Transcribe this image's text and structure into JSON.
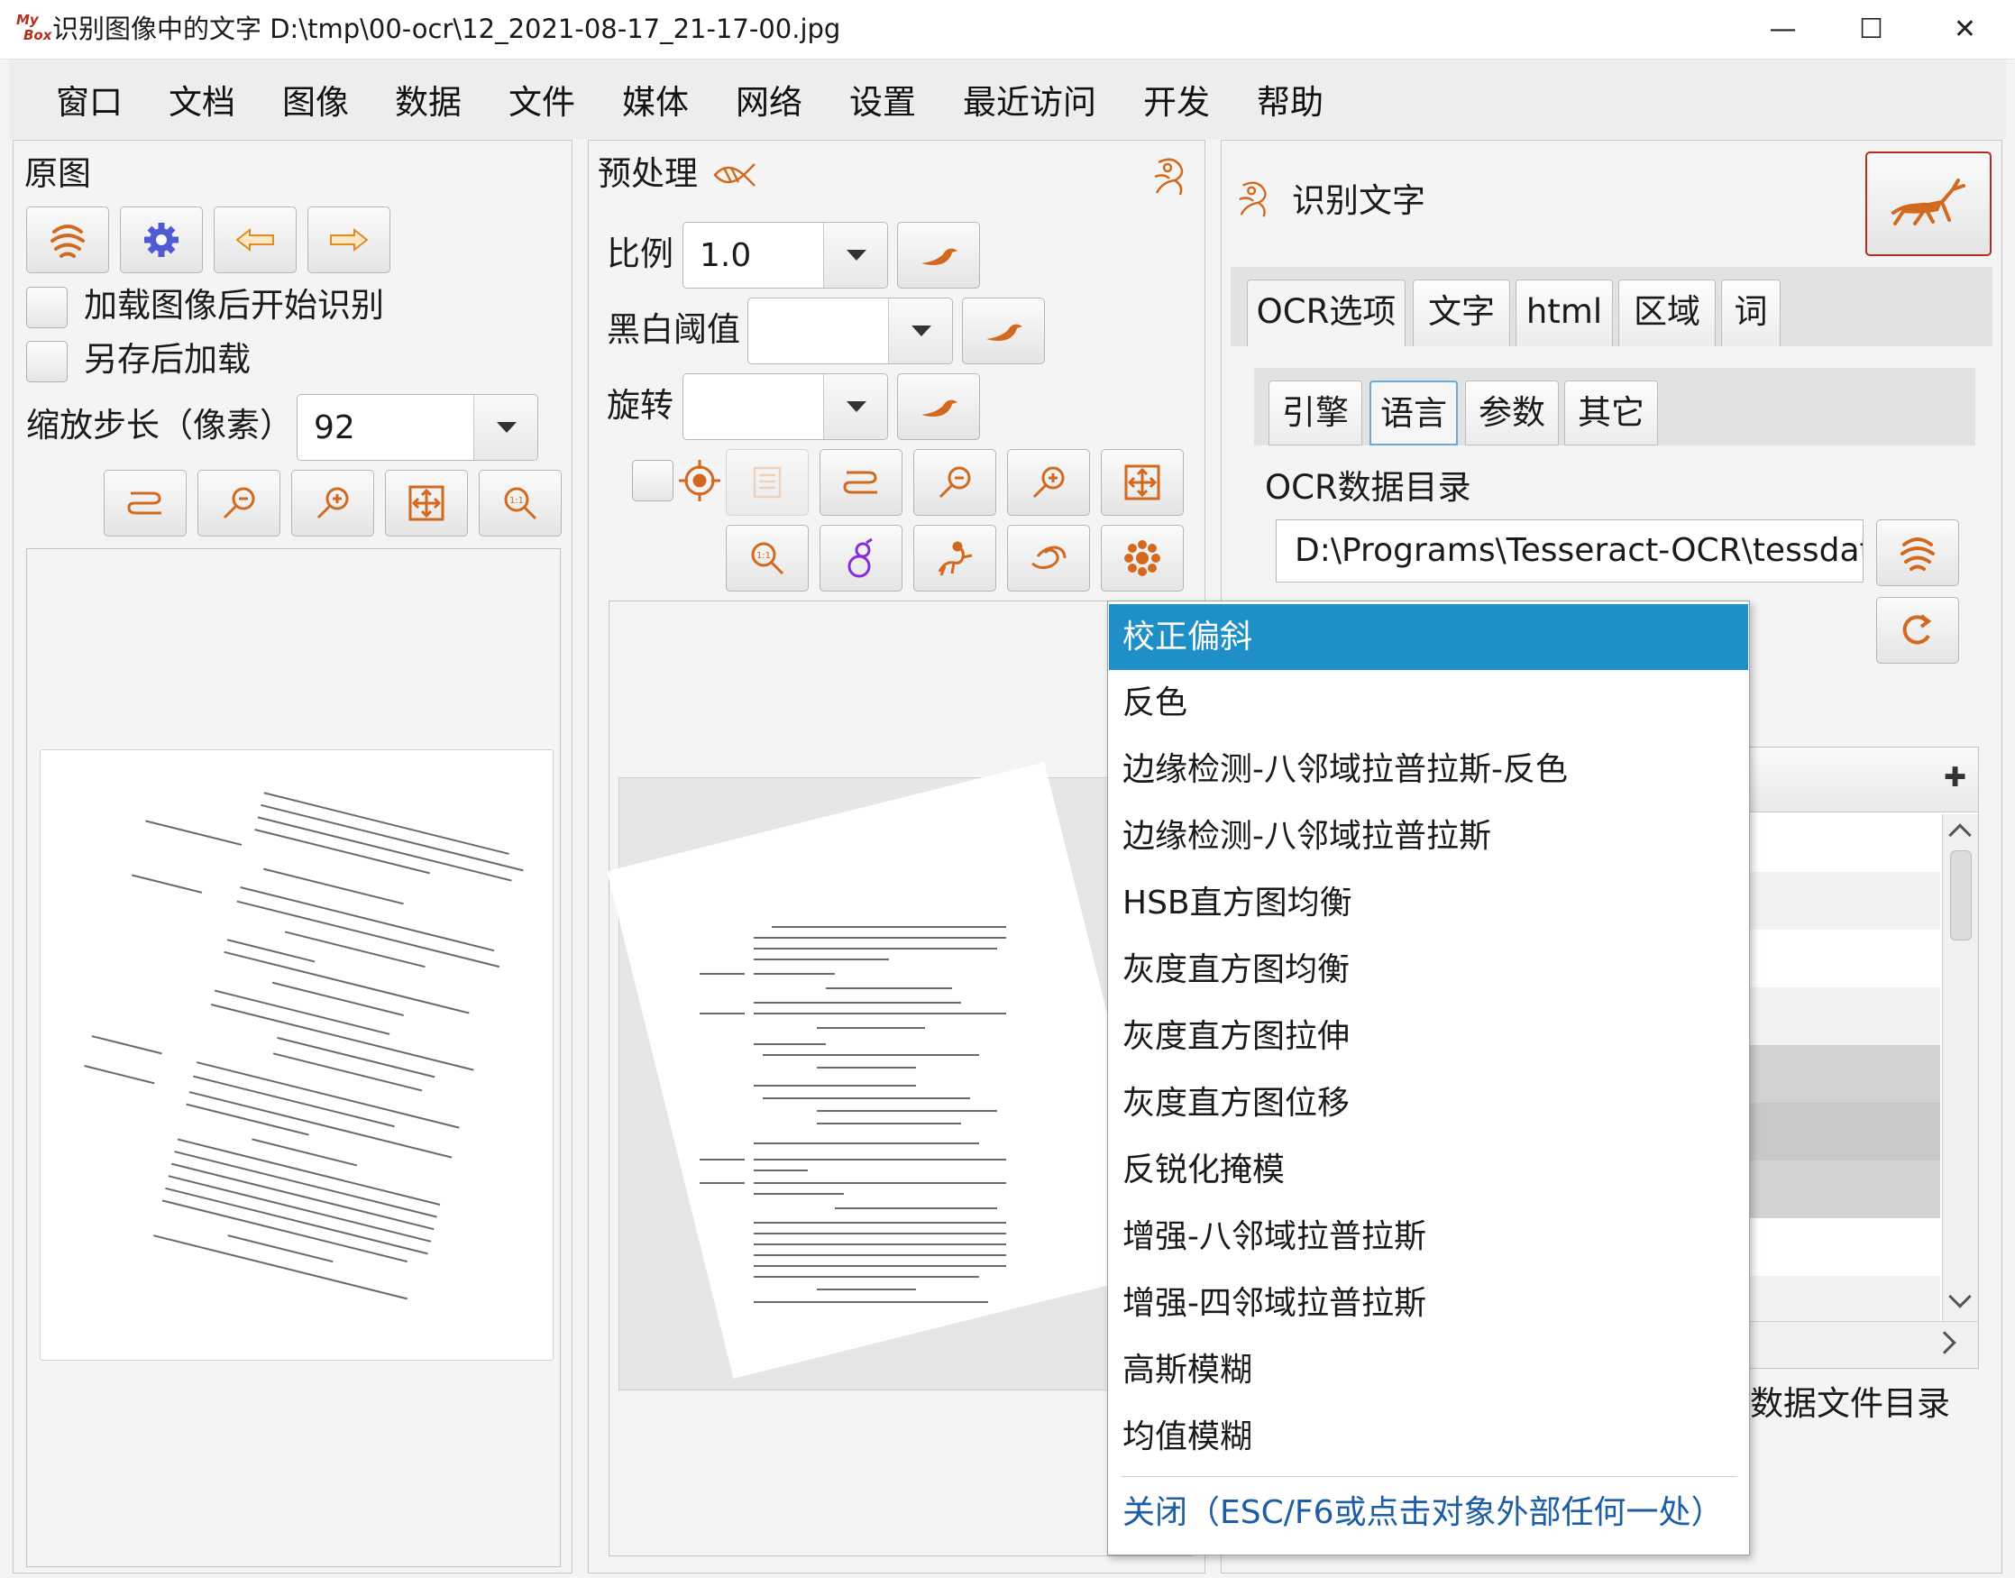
{
  "window": {
    "logo_top": "My",
    "logo_bottom": "Box",
    "title": "识别图像中的文字 D:\\tmp\\00-ocr\\12_2021-08-17_21-17-00.jpg",
    "controls": {
      "minimize": "—",
      "maximize": "☐",
      "close": "✕"
    }
  },
  "menu": [
    "窗口",
    "文档",
    "图像",
    "数据",
    "文件",
    "媒体",
    "网络",
    "设置",
    "最近访问",
    "开发",
    "帮助"
  ],
  "left_pane": {
    "title": "原图",
    "load_start_label": "加载图像后开始识别",
    "load_after_save_label": "另存后加载",
    "zoom_step_label": "缩放步长（像素）",
    "zoom_step_value": "92"
  },
  "mid_pane": {
    "title": "预处理",
    "scale_label": "比例",
    "scale_value": "1.0",
    "threshold_label": "黑白阈值",
    "threshold_value": "",
    "rotate_label": "旋转",
    "rotate_value": ""
  },
  "right_pane": {
    "title": "识别文字",
    "tabs": [
      "OCR选项",
      "文字",
      "html",
      "区域",
      "词"
    ],
    "active_tab": 0,
    "subtabs": [
      "引擎",
      "语言",
      "参数",
      "其它"
    ],
    "active_subtab": 1,
    "data_dir_label": "OCR数据目录",
    "data_dir_value": "D:\\Programs\\Tesseract-OCR\\tessdata",
    "data_file_dir_label": "数据文件目录",
    "add_symbol": "✚"
  },
  "popup_menu": {
    "items": [
      "校正偏斜",
      "反色",
      "边缘检测-八邻域拉普拉斯-反色",
      "边缘检测-八邻域拉普拉斯",
      "HSB直方图均衡",
      "灰度直方图均衡",
      "灰度直方图拉伸",
      "灰度直方图位移",
      "反锐化掩模",
      "增强-八邻域拉普拉斯",
      "增强-四邻域拉普拉斯",
      "高斯模糊",
      "均值模糊"
    ],
    "selected_index": 0,
    "close_label": "关闭（ESC/F6或点击对象外部任何一处）"
  },
  "colors": {
    "accent": "#1f8fc8",
    "icon_orange": "#d2691e",
    "link": "#1c5da6",
    "highlight_border": "#b03020"
  }
}
